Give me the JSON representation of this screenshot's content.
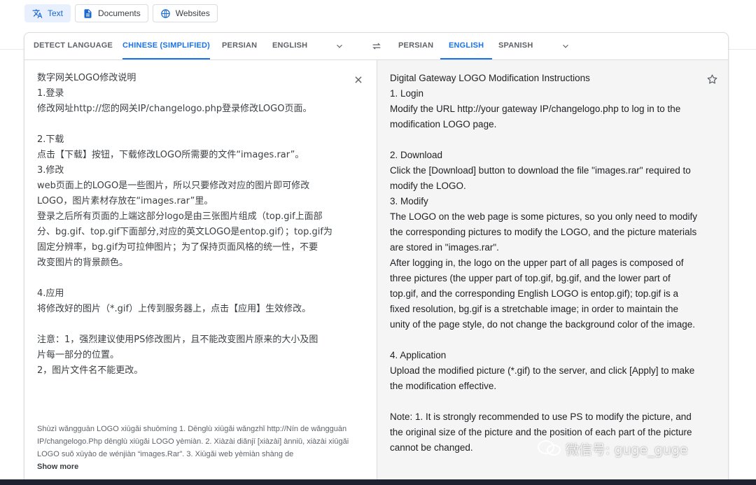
{
  "modes": [
    {
      "label": "Text",
      "icon": "translate-icon"
    },
    {
      "label": "Documents",
      "icon": "document-icon"
    },
    {
      "label": "Websites",
      "icon": "globe-icon"
    }
  ],
  "source_langs": [
    "DETECT LANGUAGE",
    "CHINESE (SIMPLIFIED)",
    "PERSIAN",
    "ENGLISH"
  ],
  "target_langs": [
    "PERSIAN",
    "ENGLISH",
    "SPANISH"
  ],
  "source_text": "数字网关LOGO修改说明\n1.登录\n修改网址http://您的网关IP/changelogo.php登录修改LOGO页面。\n\n2.下载\n点击【下载】按钮，下载修改LOGO所需要的文件“images.rar”。\n3.修改\nweb页面上的LOGO是一些图片，所以只要修改对应的图片即可修改\nLOGO，图片素材存放在“images.rar”里。\n登录之后所有页面的上端这部分logo是由三张图片组成（top.gif上面部\n分、bg.gif、top.gif下面部分,对应的英文LOGO是entop.gif）；top.gif为\n固定分辨率，bg.gif为可拉伸图片；为了保持页面风格的统一性，不要\n改变图片的背景颜色。\n\n4.应用\n将修改好的图片（*.gif）上传到服务器上，点击【应用】生效修改。\n\n注意：1，强烈建议使用PS修改图片，且不能改变图片原来的大小及图\n片每一部分的位置。\n2，图片文件名不能更改。",
  "translated_text": "Digital Gateway LOGO Modification Instructions\n1. Login\nModify the URL http://your gateway IP/changelogo.php to log in to the modification LOGO page.\n\n2. Download\nClick the [Download] button to download the file \"images.rar\" required to modify the LOGO.\n3. Modify\nThe LOGO on the web page is some pictures, so you only need to modify the corresponding pictures to modify the LOGO, and the picture materials are stored in \"images.rar\".\nAfter logging in, the logo on the upper part of all pages is composed of three pictures (the upper part of top.gif, bg.gif, and the lower part of top.gif, and the corresponding English LOGO is entop.gif); top.gif is a fixed resolution, bg.gif is a stretchable image; in order to maintain the unity of the page style, do not change the background color of the image.\n\n4. Application\nUpload the modified picture (*.gif) to the server, and click [Apply] to make the modification effective.\n\nNote: 1. It is strongly recommended to use PS to modify the picture, and the original size of the picture and the position of each part of the picture cannot be changed.",
  "transliteration": "Shùzì wǎngguān LOGO xiūgǎi shuōmíng 1. Dēnglù xiūgǎi wǎngzhǐ http://Nín de wǎngguān IP/changelogo.Php dēnglù xiūgǎi LOGO yèmiàn. 2. Xiàzài diǎnjī [xiàzài] ànniǔ, xiàzài xiūgǎi LOGO suǒ xūyào de wénjiàn “images.Rar”. 3. Xiūgǎi web yèmiàn shàng de",
  "show_more": "Show more",
  "watermark": "微信号: guge_guge",
  "colors": {
    "accent": "#1a73e8",
    "accent_bg": "#e8f0fe"
  }
}
